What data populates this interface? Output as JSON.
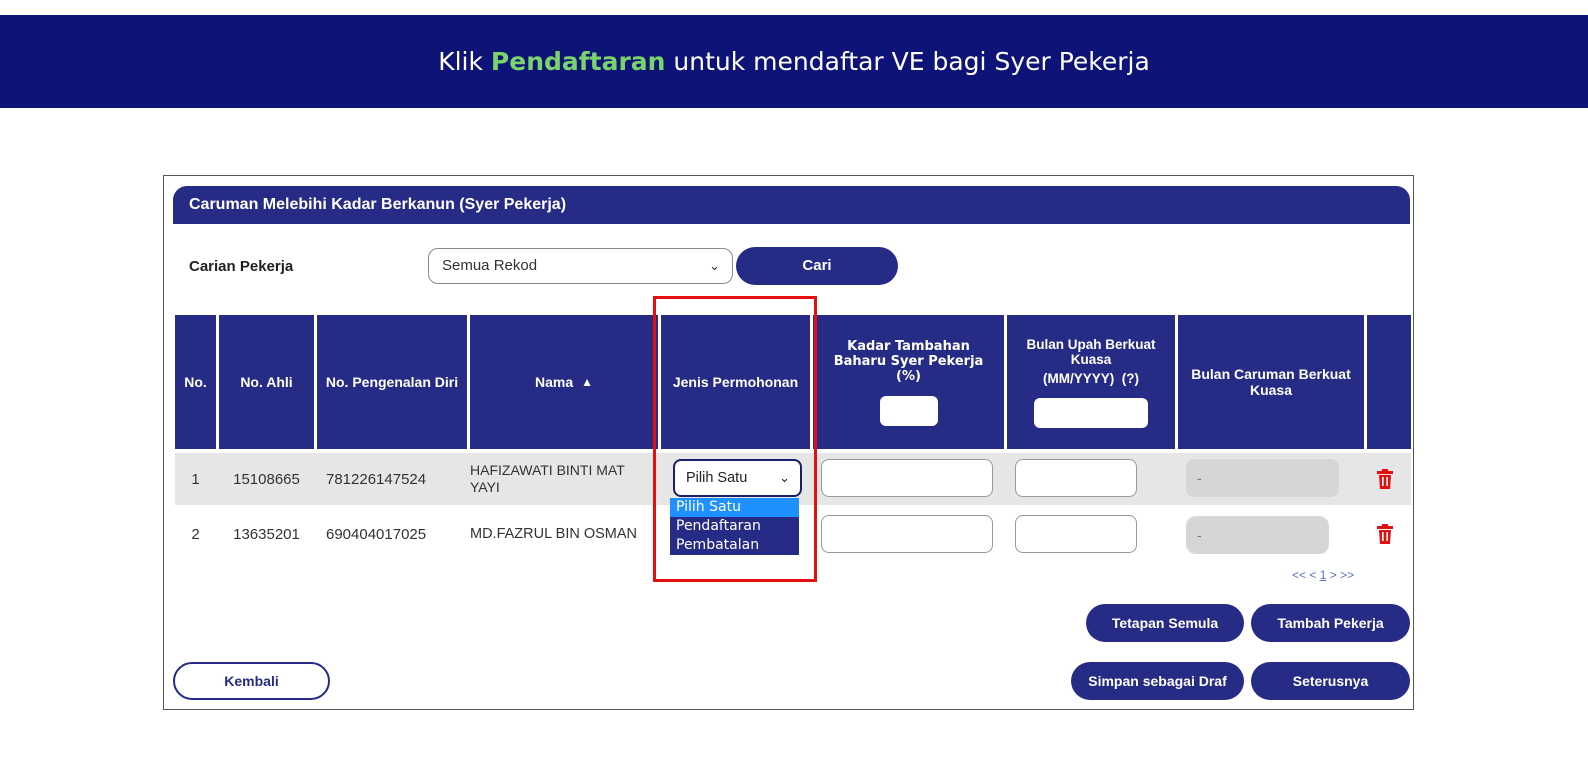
{
  "banner": {
    "prefix": "Klik ",
    "highlight": "Pendaftaran",
    "suffix": " untuk mendaftar VE bagi Syer Pekerja"
  },
  "panel": {
    "title": "Caruman Melebihi Kadar Berkanun (Syer Pekerja)"
  },
  "search": {
    "label": "Carian Pekerja",
    "selected": "Semua Rekod",
    "button": "Cari"
  },
  "table": {
    "headers": {
      "no": "No.",
      "member_no": "No. Ahli",
      "id_no": "No. Pengenalan Diri",
      "name": "Nama",
      "sort_icon": "sort-icon",
      "application_type": "Jenis Permohonan",
      "rate": "Kadar Tambahan Baharu Syer Pekerja (%)",
      "wage_month": "Bulan Upah Berkuat Kuasa",
      "wage_month_format": "(MM/YYYY)  (?)",
      "contribution_month": "Bulan Caruman Berkuat Kuasa"
    },
    "rows": [
      {
        "no": "1",
        "member_no": "15108665",
        "id_no": "781226147524",
        "name": "HAFIZAWATI BINTI MAT YAYI",
        "application_type": "Pilih Satu",
        "contribution_month": "-"
      },
      {
        "no": "2",
        "member_no": "13635201",
        "id_no": "690404017025",
        "name": "MD.FAZRUL BIN OSMAN",
        "contribution_month": "-"
      }
    ],
    "dropdown_options": [
      "Pilih Satu",
      "Pendaftaran",
      "Pembatalan"
    ],
    "dropdown_selected_index": 0
  },
  "pager": {
    "prev": "<< <",
    "page": "1",
    "next": "> >>"
  },
  "buttons": {
    "reset": "Tetapan Semula",
    "add_employee": "Tambah Pekerja",
    "back": "Kembali",
    "save_draft": "Simpan sebagai Draf",
    "next": "Seterusnya"
  },
  "colors": {
    "primary": "#262c86",
    "banner": "#0d1377",
    "highlight": "#7ad36b",
    "delete": "#e01010",
    "annotation": "#e41010"
  }
}
